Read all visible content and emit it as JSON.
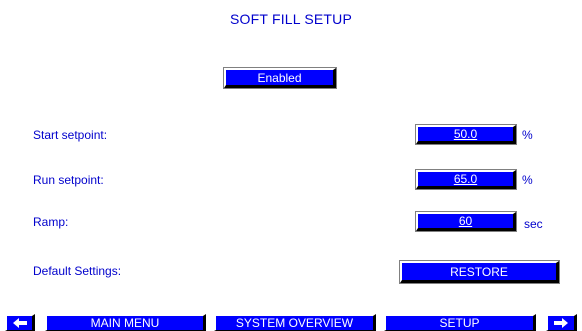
{
  "screen": {
    "title": "SOFT FILL SETUP"
  },
  "enable_button": {
    "label": "Enabled"
  },
  "fields": {
    "start_setpoint": {
      "label": "Start setpoint:",
      "value": "50.0",
      "unit": "%"
    },
    "run_setpoint": {
      "label": "Run setpoint:",
      "value": "65.0",
      "unit": "%"
    },
    "ramp": {
      "label": "Ramp:",
      "value": "60",
      "unit": "sec"
    }
  },
  "defaults": {
    "label": "Default Settings:",
    "button": "RESTORE"
  },
  "nav": {
    "prev_icon": "arrow-left-icon",
    "next_icon": "arrow-right-icon",
    "main_menu": "MAIN MENU",
    "system_overview": "SYSTEM OVERVIEW",
    "setup": "SETUP"
  },
  "colors": {
    "accent": "#0000ff",
    "text": "#0000cc",
    "background": "#ffffff"
  }
}
